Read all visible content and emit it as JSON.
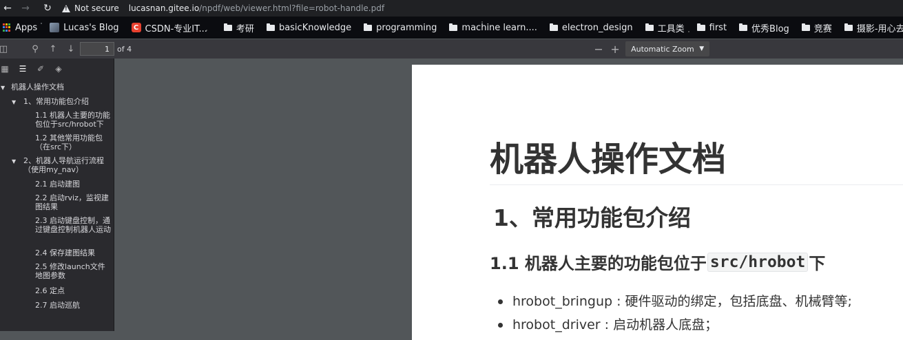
{
  "browser": {
    "security_label": "Not secure",
    "url_host": "lucasnan.gitee.io",
    "url_path": "/npdf/web/viewer.html?file=robot-handle.pdf"
  },
  "bookmarks": [
    {
      "label": "Apps",
      "icon": "apps-grid-icon"
    },
    {
      "label": "Lucas's Blog",
      "icon": "lucas-favicon"
    },
    {
      "label": "CSDN-专业IT...",
      "icon": "csdn-favicon"
    },
    {
      "label": "考研",
      "icon": "folder-icon"
    },
    {
      "label": "basicKnowledge",
      "icon": "folder-icon"
    },
    {
      "label": "programming",
      "icon": "folder-icon"
    },
    {
      "label": "machine learn....",
      "icon": "folder-icon"
    },
    {
      "label": "electron_design",
      "icon": "folder-icon"
    },
    {
      "label": "工具类",
      "icon": "folder-icon"
    },
    {
      "label": "first",
      "icon": "folder-icon"
    },
    {
      "label": "优秀Blog",
      "icon": "folder-icon"
    },
    {
      "label": "竞赛",
      "icon": "folder-icon"
    },
    {
      "label": "摄影-用心去感受",
      "icon": "folder-icon"
    }
  ],
  "pdf_toolbar": {
    "page_value": "1",
    "page_total": "of 4",
    "zoom": "Automatic Zoom"
  },
  "outline": {
    "root": "机器人操作文档",
    "sec1": "1、常用功能包介绍",
    "sec1_items": [
      "1.1 机器人主要的功能包位于src/hrobot下",
      "1.2 其他常用功能包（在src下）"
    ],
    "sec2": "2、机器人导航运行流程（使用my_nav）",
    "sec2_items": [
      "2.1 启动建图",
      "2.2 启动rviz，监视建图结果",
      "2.3 启动键盘控制，通过键盘控制机器人运动",
      "2.4 保存建图结果",
      "2.5 修改launch文件地图参数",
      "2.6 定点",
      "2.7 启动巡航"
    ]
  },
  "document": {
    "title": "机器人操作文档",
    "h1": "1、常用功能包介绍",
    "h2_prefix": "1.1 机器人主要的功能包位于",
    "h2_code": "src/hrobot",
    "h2_suffix": "下",
    "bullets": [
      "hrobot_bringup : 硬件驱动的绑定，包括底盘、机械臂等;",
      "hrobot_driver : 启动机器人底盘；"
    ]
  }
}
